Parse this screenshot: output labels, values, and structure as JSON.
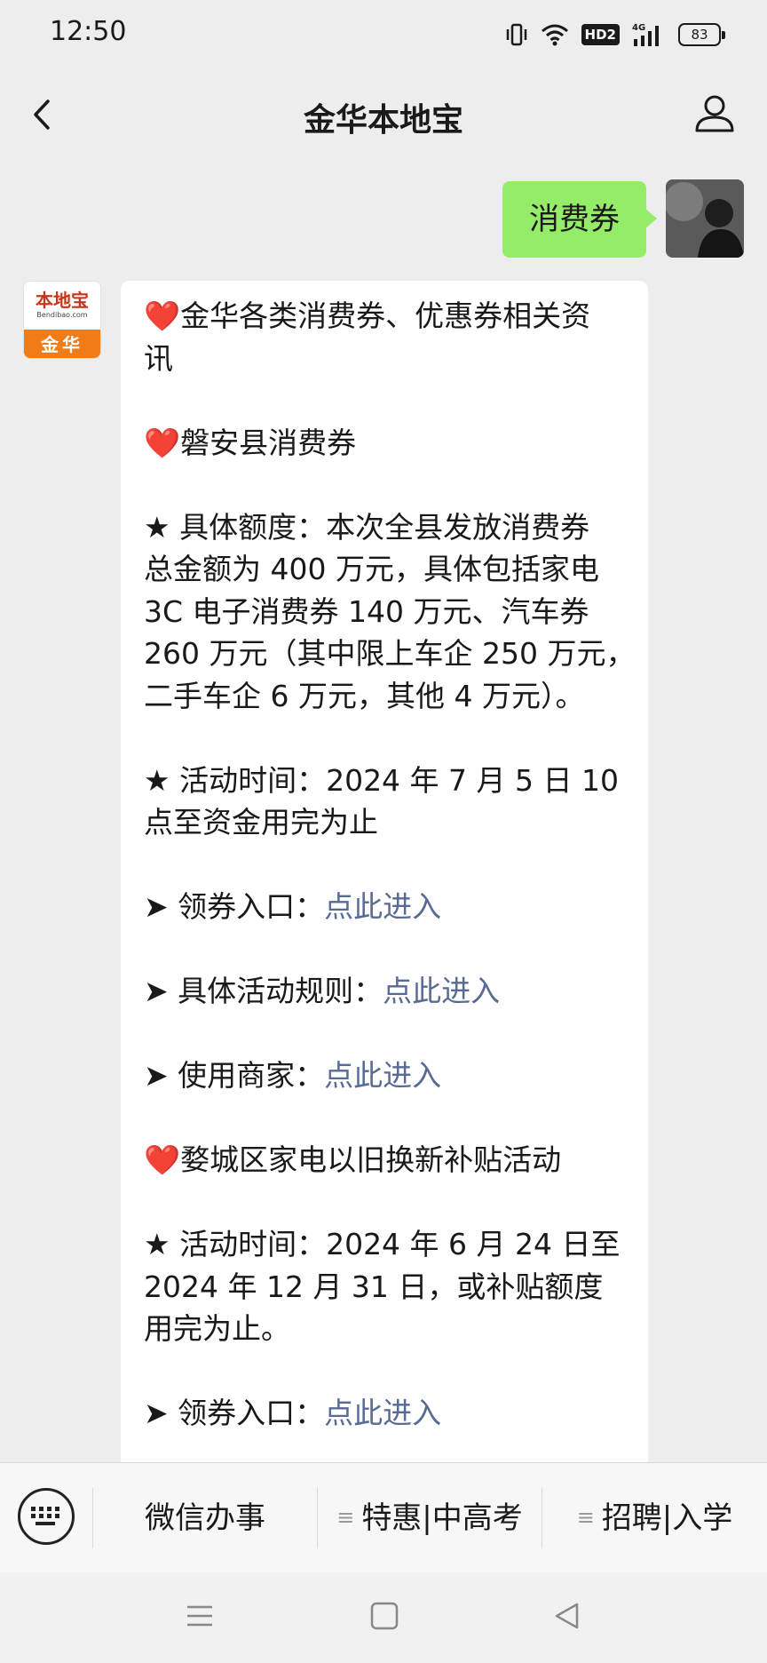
{
  "status": {
    "time": "12:50",
    "hd": "HD2",
    "network": "4G",
    "battery": "83"
  },
  "nav": {
    "title": "金华本地宝"
  },
  "chat": {
    "user_message": "消费券",
    "bot_logo": {
      "main": "本地宝",
      "sub": "Bendibao.com",
      "city": "金华"
    },
    "lines": {
      "l1": "❤️金华各类消费券、优惠券相关资",
      "l2": "讯",
      "l3": "❤️磐安县消费券",
      "l4": "★ 具体额度：本次全县发放消费券",
      "l5": "总金额为 400 万元，具体包括家电",
      "l6": "3C 电子消费券 140 万元、汽车券",
      "l7": "260 万元（其中限上车企 250 万元，",
      "l8": "二手车企 6 万元，其他 4 万元）。",
      "l9": "★ 活动时间：2024 年 7 月 5 日 10",
      "l10": "点至资金用完为止",
      "l11_label": "➤ 领券入口：",
      "l11_link": "点此进入",
      "l12_label": "➤ 具体活动规则：",
      "l12_link": "点此进入",
      "l13_label": "➤ 使用商家：",
      "l13_link": "点此进入",
      "l14": "❤️婺城区家电以旧换新补贴活动",
      "l15": "★ 活动时间：2024 年 6 月 24 日至",
      "l16": "2024 年 12 月 31 日，或补贴额度",
      "l17": "用完为止。",
      "l18_label": "➤ 领券入口：",
      "l18_link": "点此进入"
    }
  },
  "menu": {
    "item1": "微信办事",
    "item2": "特惠|中高考",
    "item3": "招聘|入学"
  },
  "colors": {
    "background": "#ededed",
    "user_bubble": "#95ec69",
    "link": "#576b95",
    "logo_orange": "#f07b17",
    "logo_red": "#c8341b"
  }
}
